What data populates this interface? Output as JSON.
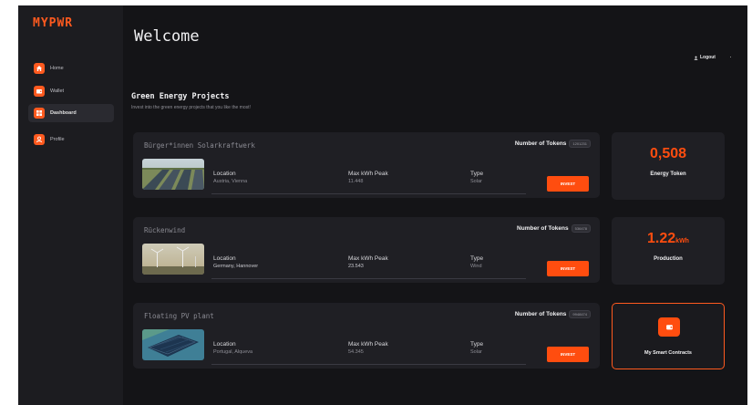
{
  "app": {
    "logo": "MYPWR"
  },
  "sidebar": {
    "items": [
      {
        "label": "Home",
        "icon": "home-icon"
      },
      {
        "label": "Wallet",
        "icon": "wallet-icon"
      },
      {
        "label": "Dashboard",
        "icon": "dashboard-icon",
        "active": true
      },
      {
        "label": "Profile",
        "icon": "user-icon"
      }
    ]
  },
  "header": {
    "title": "Welcome",
    "logout_label": "Logout",
    "logout_icon": "user-icon"
  },
  "section": {
    "title": "Green Energy Projects",
    "subtitle": "Invest into the green energy projects that you like the most!"
  },
  "projects": [
    {
      "name": "Bürger*innen Solarkraftwerk",
      "tokens_label": "Number of Tokens",
      "tokens_count": "1201231",
      "location_label": "Location",
      "location": "Austria, Vienna",
      "peak_label": "Max kWh Peak",
      "peak": "11.448",
      "type_label": "Type",
      "type": "Solar",
      "invest_label": "INVEST"
    },
    {
      "name": "Rückenwind",
      "tokens_label": "Number of Tokens",
      "tokens_count": "536478",
      "location_label": "Location",
      "location": "Germany, Hannover",
      "peak_label": "Max kWh Peak",
      "peak": "23.543",
      "type_label": "Type",
      "type": "Wind",
      "invest_label": "INVEST"
    },
    {
      "name": "Floating PV plant",
      "tokens_label": "Number of Tokens",
      "tokens_count": "9948474",
      "location_label": "Location",
      "location": "Portugal, Alqueva",
      "peak_label": "Max kWh Peak",
      "peak": "54.345",
      "type_label": "Type",
      "type": "Solar",
      "invest_label": "INVEST"
    }
  ],
  "stats": {
    "energy": {
      "value": "0,508",
      "label": "Energy Token"
    },
    "production": {
      "value": "1.22",
      "unit": "kWh",
      "label": "Production"
    },
    "contracts": {
      "label": "My Smart Contracts",
      "icon": "wallet-icon"
    }
  },
  "colors": {
    "accent": "#ff4d0f",
    "background": "#141417",
    "card": "#1f1f24",
    "sidebar": "#1c1c20"
  }
}
